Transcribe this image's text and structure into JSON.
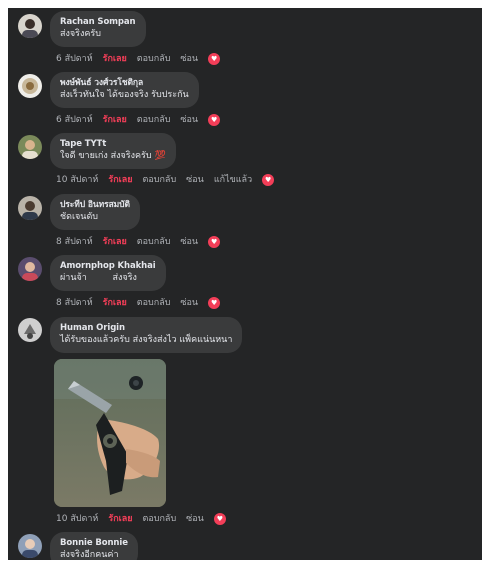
{
  "comments": [
    {
      "author": "Rachan Sompan",
      "text": "ส่งจริงครับ",
      "time": "6 สัปดาห์",
      "love": "รักเลย",
      "reply": "ตอบกลับ",
      "hide": "ซ่อน"
    },
    {
      "author": "พงษ์พันธ์ วงศ์วรโชติกุล",
      "text": "ส่งเร็วทันใจ ได้ของจริง รับประกัน",
      "time": "6 สัปดาห์",
      "love": "รักเลย",
      "reply": "ตอบกลับ",
      "hide": "ซ่อน"
    },
    {
      "author": "Tape TYTt",
      "text": "ใจดี ขายเก่ง ส่งจริงครับ",
      "time": "10 สัปดาห์",
      "love": "รักเลย",
      "reply": "ตอบกลับ",
      "hide": "ซ่อน",
      "edited": "แก้ไขแล้ว"
    },
    {
      "author": "ประทีป อินทรสมบัติ",
      "text": "ชัดเจนดับ",
      "time": "8 สัปดาห์",
      "love": "รักเลย",
      "reply": "ตอบกลับ",
      "hide": "ซ่อน"
    },
    {
      "author": "Amornphop Khakhai",
      "text": "ผ่านจ้า         ส่งจริง",
      "time": "8 สัปดาห์",
      "love": "รักเลย",
      "reply": "ตอบกลับ",
      "hide": "ซ่อน"
    },
    {
      "author": "Human Origin",
      "text": "ได้รับของแล้วครับ ส่งจริงส่งไว แพ็คแน่นหนา",
      "time": "10 สัปดาห์",
      "love": "รักเลย",
      "reply": "ตอบกลับ",
      "hide": "ซ่อน"
    },
    {
      "author": "Bonnie Bonnie",
      "text": "ส่งจริงอีกคนค่า"
    }
  ],
  "icons": {
    "reaction": "heart-reaction-icon",
    "emoji": "red-heart-emoji"
  },
  "colors": {
    "background": "#242526",
    "bubble": "#3a3b3c",
    "love": "#f33e58",
    "meta": "#b0b3b8"
  }
}
